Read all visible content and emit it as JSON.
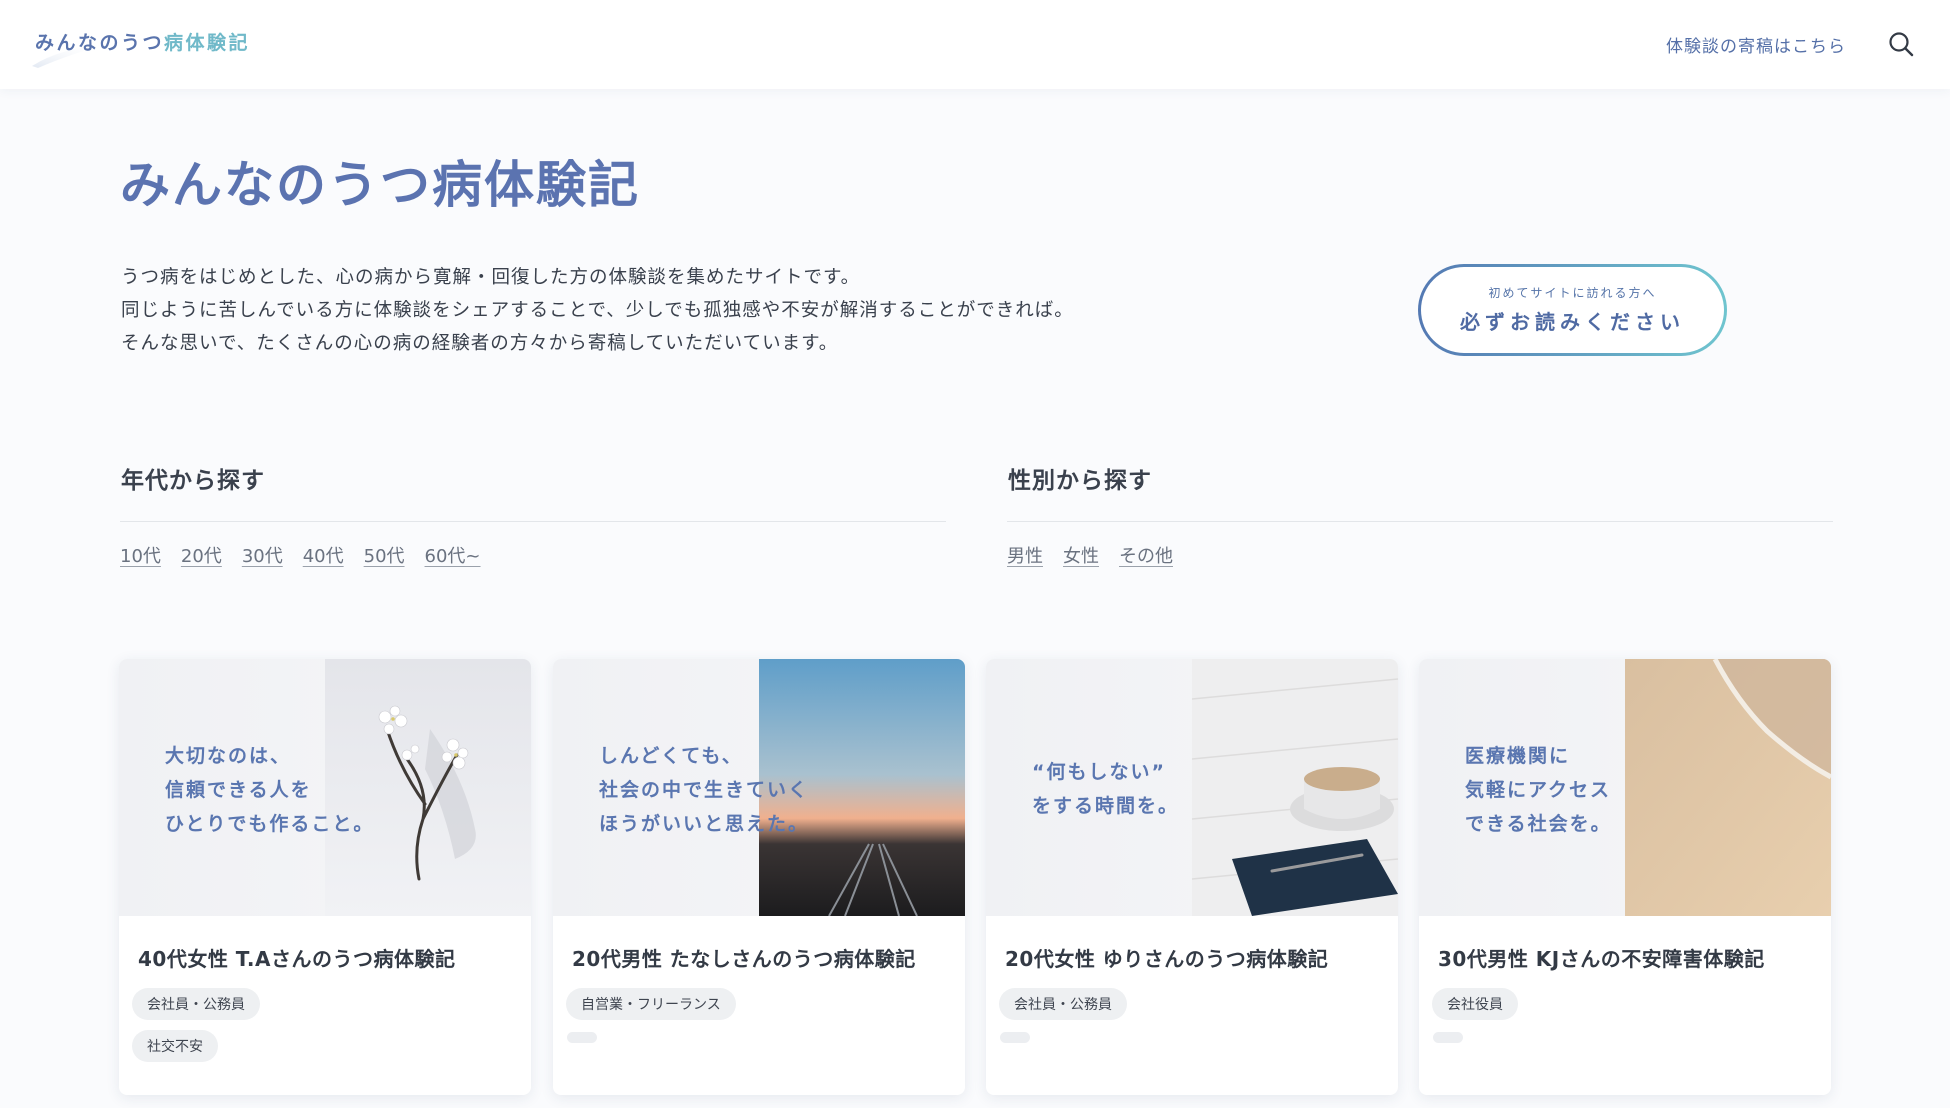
{
  "header": {
    "logo_main": "みんなのうつ",
    "logo_accent": "病体験記",
    "contribute_link": "体験談の寄稿はこちら",
    "search_icon": "search-icon"
  },
  "hero": {
    "title": "みんなのうつ病体験記",
    "lines": [
      "うつ病をはじめとした、心の病から寛解・回復した方の体験談を集めたサイトです。",
      "同じように苦しんでいる方に体験談をシェアすることで、少しでも孤独感や不安が解消することができれば。",
      "そんな思いで、たくさんの心の病の経験者の方々から寄稿していただいています。"
    ],
    "button_sub": "初めてサイトに訪れる方へ",
    "button_main": "必ずお読みください"
  },
  "filters": {
    "age": {
      "title": "年代から探す",
      "links": [
        "10代",
        "20代",
        "30代",
        "40代",
        "50代",
        "60代~"
      ]
    },
    "gender": {
      "title": "性別から探す",
      "links": [
        "男性",
        "女性",
        "その他"
      ]
    }
  },
  "cards": [
    {
      "quote": "大切なのは、\n信頼できる人を\nひとりでも作ること。",
      "photo": "white-flower-branch",
      "title": "40代女性 T.Aさんのうつ病体験記",
      "tags": [
        "会社員・公務員",
        "社交不安"
      ]
    },
    {
      "quote": "しんどくても、\n社会の中で生きていく\nほうがいいと思えた。",
      "photo": "sunset-railway",
      "title": "20代男性 たなしさんのうつ病体験記",
      "tags": [
        "自営業・フリーランス"
      ]
    },
    {
      "quote": "“何もしない”\nをする時間を。",
      "photo": "coffee-cup-notebook",
      "title": "20代女性 ゆりさんのうつ病体験記",
      "tags": [
        "会社員・公務員"
      ]
    },
    {
      "quote": "医療機関に\n気軽にアクセス\nできる社会を。",
      "photo": "beach-shore",
      "title": "30代男性 KJさんの不安障害体験記",
      "tags": [
        "会社役員"
      ]
    }
  ],
  "colors": {
    "brand": "#5b73b0",
    "accent": "#70b9c9",
    "background": "#fafbfd"
  }
}
